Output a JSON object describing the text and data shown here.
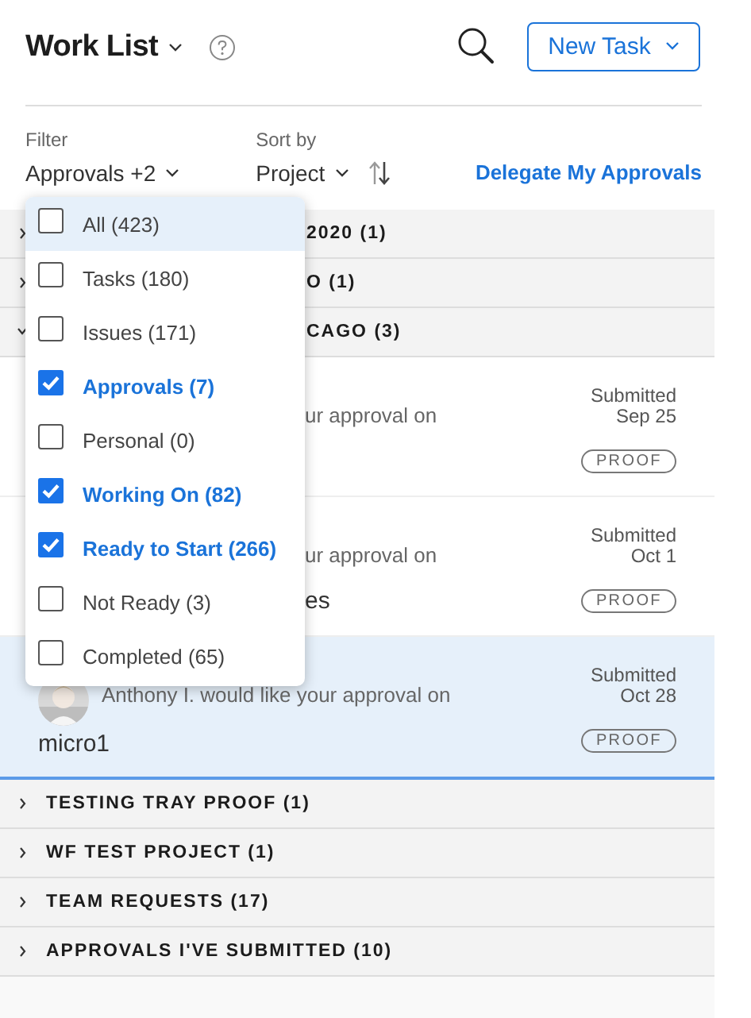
{
  "header": {
    "title": "Work List",
    "new_task_button": "New Task"
  },
  "filter": {
    "label": "Filter",
    "value": "Approvals +2"
  },
  "sort": {
    "label": "Sort by",
    "value": "Project"
  },
  "delegate_link": "Delegate My Approvals",
  "filter_menu": {
    "options": [
      {
        "label": "All (423)",
        "checked": false,
        "highlighted": true
      },
      {
        "label": "Tasks (180)",
        "checked": false,
        "highlighted": false
      },
      {
        "label": "Issues (171)",
        "checked": false,
        "highlighted": false
      },
      {
        "label": "Approvals (7)",
        "checked": true,
        "highlighted": false
      },
      {
        "label": "Personal (0)",
        "checked": false,
        "highlighted": false
      },
      {
        "label": "Working On (82)",
        "checked": true,
        "highlighted": false
      },
      {
        "label": "Ready to Start (266)",
        "checked": true,
        "highlighted": false
      },
      {
        "label": "Not Ready (3)",
        "checked": false,
        "highlighted": false
      },
      {
        "label": "Completed (65)",
        "checked": false,
        "highlighted": false
      }
    ]
  },
  "groups": [
    {
      "title": "2020 (1)",
      "expanded": false
    },
    {
      "title": "O (1)",
      "expanded": false
    },
    {
      "title": "CAGO (3)",
      "expanded": true,
      "items": [
        {
          "lines": [
            "ur approval on"
          ],
          "status": "Submitted",
          "date": "Sep 25",
          "badge": "PROOF",
          "selected": false
        },
        {
          "lines": [
            "ur approval on",
            "es"
          ],
          "status": "Submitted",
          "date": "Oct 1",
          "badge": "PROOF",
          "selected": false
        },
        {
          "avatar": {
            "kind": "picture"
          },
          "lines": [
            "Anthony I. would like your approval on",
            "micro1"
          ],
          "status": "Submitted",
          "date": "Oct 28",
          "badge": "PROOF",
          "selected": true
        }
      ]
    },
    {
      "title": "TESTING TRAY PROOF (1)",
      "expanded": false
    },
    {
      "title": "WF TEST PROJECT (1)",
      "expanded": false
    },
    {
      "title": "TEAM REQUESTS (17)",
      "expanded": false
    },
    {
      "title": "APPROVALS I'VE SUBMITTED (10)",
      "expanded": false
    }
  ]
}
